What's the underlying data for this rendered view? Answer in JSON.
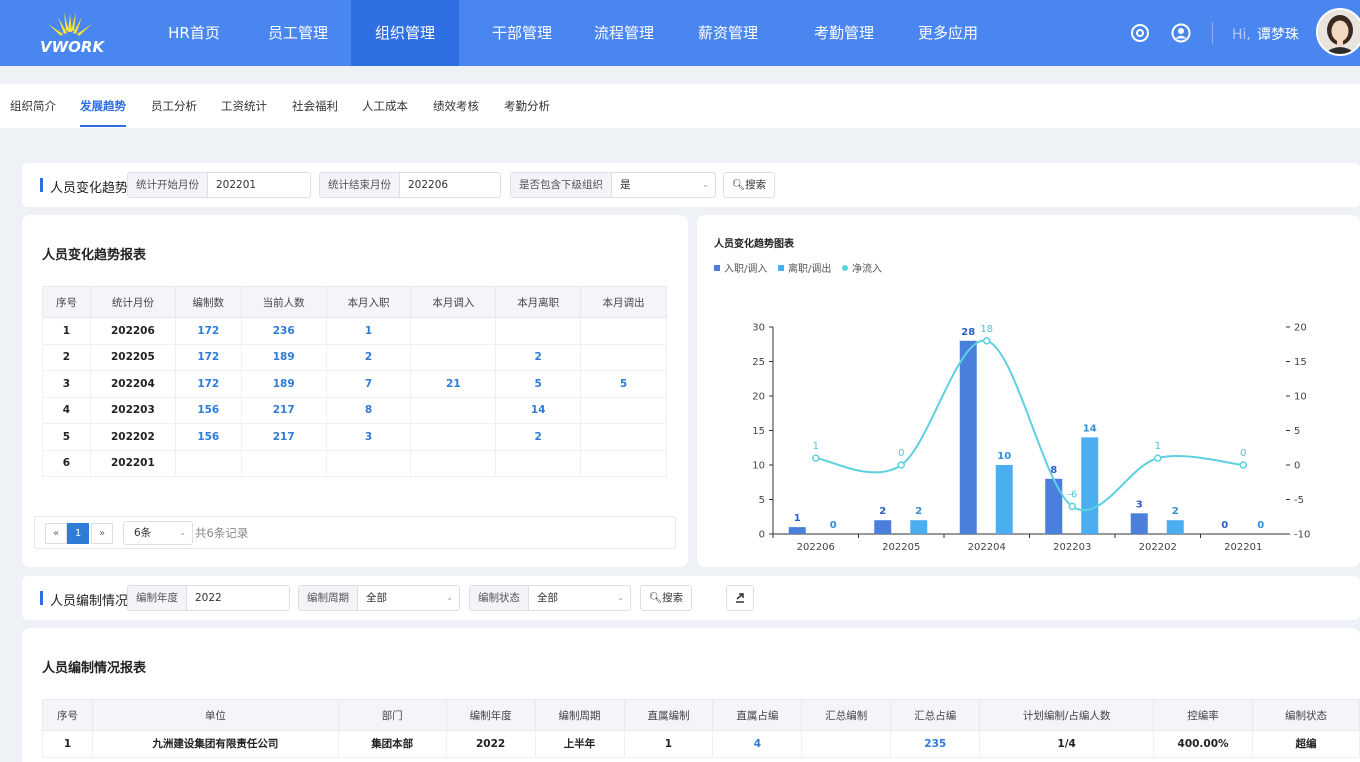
{
  "header": {
    "logo": "VWORK",
    "nav": [
      "HR首页",
      "员工管理",
      "组织管理",
      "干部管理",
      "流程管理",
      "薪资管理",
      "考勤管理",
      "更多应用"
    ],
    "active_nav": "组织管理",
    "greeting_prefix": "Hi,",
    "user_name": "谭梦珠",
    "icons": [
      "settings-icon",
      "user-icon"
    ]
  },
  "subnav": {
    "items": [
      "组织简介",
      "发展趋势",
      "员工分析",
      "工资统计",
      "社会福利",
      "人工成本",
      "绩效考核",
      "考勤分析"
    ],
    "active": "发展趋势"
  },
  "filter1": {
    "title": "人员变化趋势",
    "start_label": "统计开始月份",
    "start_value": "202201",
    "end_label": "统计结束月份",
    "end_value": "202206",
    "sub_label": "是否包含下级组织",
    "sub_value": "是",
    "search": "搜索"
  },
  "report1": {
    "title": "人员变化趋势报表",
    "columns": [
      "序号",
      "统计月份",
      "编制数",
      "当前人数",
      "本月入职",
      "本月调入",
      "本月离职",
      "本月调出"
    ],
    "rows": [
      [
        "1",
        "202206",
        "172",
        "236",
        "1",
        "",
        "",
        ""
      ],
      [
        "2",
        "202205",
        "172",
        "189",
        "2",
        "",
        "2",
        ""
      ],
      [
        "3",
        "202204",
        "172",
        "189",
        "7",
        "21",
        "5",
        "5"
      ],
      [
        "4",
        "202203",
        "156",
        "217",
        "8",
        "",
        "14",
        ""
      ],
      [
        "5",
        "202202",
        "156",
        "217",
        "3",
        "",
        "2",
        ""
      ],
      [
        "6",
        "202201",
        "",
        "",
        "",
        "",
        "",
        ""
      ]
    ],
    "pager": {
      "prev": "«",
      "page": "1",
      "next": "»",
      "size": "6条",
      "total": "共6条记录"
    }
  },
  "chart_title": "人员变化趋势图表",
  "chart_data": {
    "type": "bar",
    "title": "人员变化趋势图表",
    "categories": [
      "202206",
      "202205",
      "202204",
      "202203",
      "202202",
      "202201"
    ],
    "series": [
      {
        "name": "入职/调入",
        "type": "bar",
        "color": "#4a7fdc",
        "values": [
          1,
          2,
          28,
          8,
          3,
          0
        ]
      },
      {
        "name": "离职/调出",
        "type": "bar",
        "color": "#4baef0",
        "values": [
          0,
          2,
          10,
          14,
          2,
          0
        ]
      },
      {
        "name": "净流入",
        "type": "line",
        "color": "#5cd1e0",
        "axis": "right",
        "values": [
          1,
          0,
          18,
          -6,
          1,
          0
        ]
      }
    ],
    "ylim_left": [
      0,
      30
    ],
    "yticks_left": [
      0,
      5,
      10,
      15,
      20,
      25,
      30
    ],
    "ylim_right": [
      -10,
      20
    ],
    "yticks_right": [
      -10,
      -5,
      0,
      5,
      10,
      15,
      20
    ],
    "legend_position": "top-left",
    "grid": false
  },
  "filter2": {
    "title": "人员编制情况",
    "year_label": "编制年度",
    "year_value": "2022",
    "period_label": "编制周期",
    "period_value": "全部",
    "status_label": "编制状态",
    "status_value": "全部",
    "search": "搜索"
  },
  "report2": {
    "title": "人员编制情况报表",
    "columns": [
      "序号",
      "单位",
      "部门",
      "编制年度",
      "编制周期",
      "直属编制",
      "直属占编",
      "汇总编制",
      "汇总占编",
      "计划编制/占编人数",
      "控编率",
      "编制状态"
    ],
    "rows": [
      [
        "1",
        "九洲建设集团有限责任公司",
        "集团本部",
        "2022",
        "上半年",
        "1",
        "4",
        "",
        "235",
        "1/4",
        "400.00%",
        "超编"
      ]
    ]
  }
}
